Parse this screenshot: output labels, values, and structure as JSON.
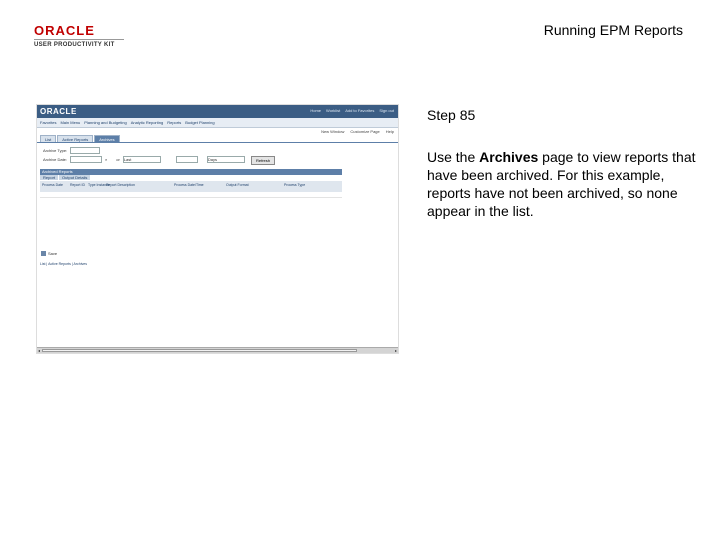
{
  "header": {
    "logo_brand": "ORACLE",
    "logo_product": "USER PRODUCTIVITY KIT",
    "title": "Running EPM Reports"
  },
  "app": {
    "brand": "ORACLE",
    "top_links": [
      "Home",
      "Worklist",
      "Add to Favorites",
      "Sign out"
    ],
    "menu_items": [
      "Favorites",
      "Main Menu",
      "Planning and Budgeting",
      "Analytic Reporting",
      "Reports",
      "Budget Planning"
    ],
    "util_links": [
      "New Window",
      "Customize Page",
      "Help"
    ],
    "tabs": [
      {
        "label": "List",
        "active": false
      },
      {
        "label": "Active Reports",
        "active": false
      },
      {
        "label": "Archives",
        "active": true
      }
    ],
    "criteria": {
      "archive_type_label": "Archive Type:",
      "from_label": "Archive Date:",
      "or_label": "or",
      "last_value": "Last",
      "days_value": "Days",
      "refresh_label": "Refresh"
    },
    "grid": {
      "title": "Archived Reports",
      "tabs": [
        "Report",
        "Output Details"
      ],
      "columns": [
        "Process Date",
        "Report ID",
        "Type Instance",
        "Report Description",
        "Process Date/Time",
        "Output Format",
        "Process Type"
      ]
    },
    "save_label": "Save",
    "bottom_links": "List | Active Reports | Archives"
  },
  "step": {
    "label": "Step 85",
    "text_before": "Use the ",
    "text_bold": "Archives",
    "text_after": " page to view reports that have been archived. For this example, reports have not been archived, so none appear in the list."
  }
}
